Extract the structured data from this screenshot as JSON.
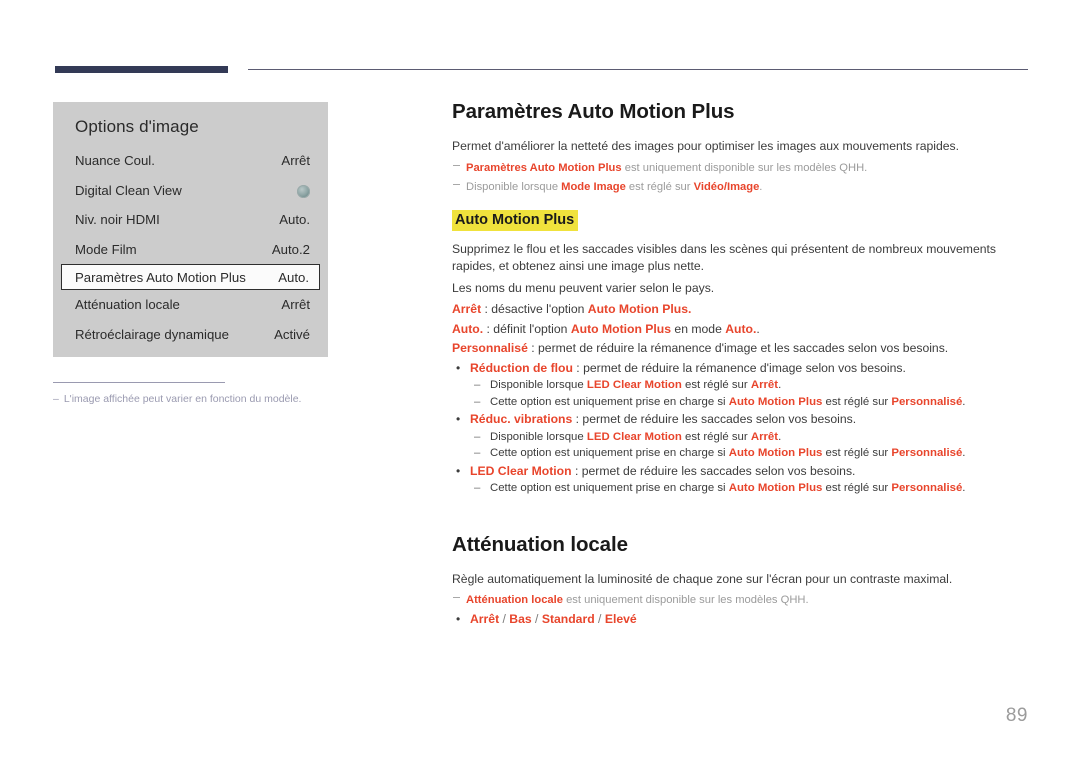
{
  "header": {
    "rule_thick_color": "#333a56",
    "rule_thin_color": "#5b5b72"
  },
  "menu_panel": {
    "title": "Options d'image",
    "rows": [
      {
        "label": "Nuance Coul.",
        "value": "Arrêt",
        "type": "text",
        "selected": false
      },
      {
        "label": "Digital Clean View",
        "value": "",
        "type": "toggle",
        "selected": false
      },
      {
        "label": "Niv. noir HDMI",
        "value": "Auto.",
        "type": "text",
        "selected": false
      },
      {
        "label": "Mode Film",
        "value": "Auto.2",
        "type": "text",
        "selected": false
      },
      {
        "label": "Paramètres Auto Motion Plus",
        "value": "Auto.",
        "type": "text",
        "selected": true
      },
      {
        "label": "Atténuation locale",
        "value": "Arrêt",
        "type": "text",
        "selected": false
      },
      {
        "label": "Rétroéclairage dynamique",
        "value": "Activé",
        "type": "text",
        "selected": false
      }
    ],
    "footnote_dash": "–",
    "footnote": "L'image affichée peut varier en fonction du modèle."
  },
  "content": {
    "section1": {
      "title": "Paramètres Auto Motion Plus",
      "intro": "Permet d'améliorer la netteté des images pour optimiser les images aux mouvements rapides.",
      "note1_a": "Paramètres Auto Motion Plus",
      "note1_b": " est uniquement disponible sur les modèles QHH.",
      "note2_a": "Disponible lorsque ",
      "note2_b": "Mode Image",
      "note2_c": " est réglé sur ",
      "note2_d": "Vidéo/Image",
      "note2_e": ".",
      "highlight_heading": "Auto Motion Plus",
      "para1": "Supprimez le flou et les saccades visibles dans les scènes qui présentent de nombreux mouvements rapides, et obtenez ainsi une image plus nette.",
      "para2": "Les noms du menu peuvent varier selon le pays.",
      "opt_arret_term": "Arrêt",
      "opt_arret_mid": " : désactive l'option ",
      "opt_arret_ref": "Auto Motion Plus.",
      "opt_auto_term": "Auto.",
      "opt_auto_mid": " : définit l'option ",
      "opt_auto_ref": "Auto Motion Plus",
      "opt_auto_mid2": " en mode ",
      "opt_auto_ref2": "Auto.",
      "opt_auto_end": ".",
      "opt_perso_term": "Personnalisé",
      "opt_perso_rest": " : permet de réduire la rémanence d'image et les saccades selon vos besoins.",
      "bullets": [
        {
          "term": "Réduction de flou",
          "rest": " : permet de réduire la rémanence d'image selon vos besoins.",
          "subs": [
            {
              "p1": "Disponible lorsque ",
              "r1": "LED Clear Motion",
              "p2": " est réglé sur ",
              "r2": "Arrêt",
              "p3": "."
            },
            {
              "p1": "Cette option est uniquement prise en charge si ",
              "r1": "Auto Motion Plus",
              "p2": " est réglé sur ",
              "r2": "Personnalisé",
              "p3": "."
            }
          ]
        },
        {
          "term": "Réduc. vibrations",
          "rest": " : permet de réduire les saccades selon vos besoins.",
          "subs": [
            {
              "p1": "Disponible lorsque ",
              "r1": "LED Clear Motion",
              "p2": " est réglé sur ",
              "r2": "Arrêt",
              "p3": "."
            },
            {
              "p1": "Cette option est uniquement prise en charge si ",
              "r1": "Auto Motion Plus",
              "p2": " est réglé sur ",
              "r2": "Personnalisé",
              "p3": "."
            }
          ]
        },
        {
          "term": "LED Clear Motion",
          "rest": " : permet de réduire les saccades selon vos besoins.",
          "subs": [
            {
              "p1": "Cette option est uniquement prise en charge si ",
              "r1": "Auto Motion Plus",
              "p2": " est réglé sur ",
              "r2": "Personnalisé",
              "p3": "."
            }
          ]
        }
      ]
    },
    "section2": {
      "title": "Atténuation locale",
      "intro": "Règle automatiquement la luminosité de chaque zone sur l'écran pour un contraste maximal.",
      "note_a": "Atténuation locale",
      "note_b": " est uniquement disponible sur les modèles QHH.",
      "values": [
        "Arrêt",
        "Bas",
        "Standard",
        "Elevé"
      ],
      "separator": " / "
    }
  },
  "page_number": "89",
  "colors": {
    "accent_red": "#e8452c",
    "highlight_yellow": "#f0e23c",
    "panel_gray": "#cccccc",
    "rule_navy": "#333a56"
  }
}
